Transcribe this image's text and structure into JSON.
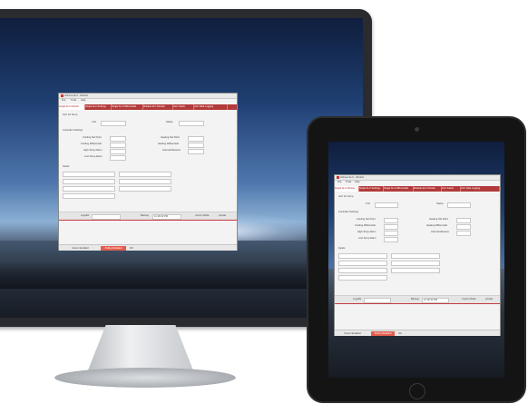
{
  "app": {
    "window_title": "Holmes ALC - Monitor",
    "menu": [
      "File",
      "Tools",
      "Help"
    ],
    "tabs": [
      "Single ALC Monitor",
      "Single ALC Settings",
      "Single ALC Differentials",
      "Multiple ALC Monitor",
      "ALC Faults",
      "ALC Data Logging"
    ],
    "section_alc": "ALC for Temp",
    "labels": {
      "unit": "Unit",
      "status": "Status",
      "controller_settings": "Controller Settings",
      "cooling_set_point": "Cooling Set Point",
      "cooling_differential": "Cooling Differential",
      "high_temp_alarm": "High Temp Alarm",
      "low_temp_alarm": "Low Temp Alarm",
      "heating_set_point": "Heating Set Point",
      "heating_differential": "Heating Differential",
      "interval_measure": "Interval Measure",
      "faults": "Faults",
      "logsdir": "LogsDir",
      "backup": "Backup",
      "backup_value": "11:18:40 PM",
      "comm_mode": "Comm Mode",
      "comm_value": "private",
      "comm_enabled": "Comm Enabled",
      "toggle_btn": "Polling Disabled",
      "ok": "OK"
    }
  }
}
